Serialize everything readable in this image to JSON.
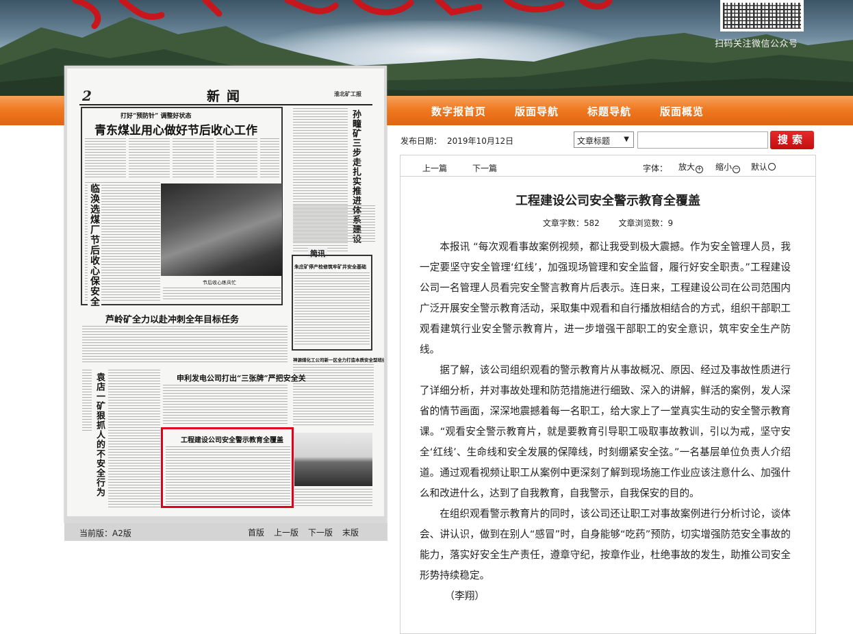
{
  "banner": {
    "qr_caption": "扫码关注微信公众号"
  },
  "nav": {
    "items": [
      "数字报首页",
      "版面导航",
      "标题导航",
      "版面概览"
    ]
  },
  "paper": {
    "page_number": "2",
    "section": "新闻",
    "masthead": "淮北矿工报",
    "headlines": {
      "kicker": "打好“预防针” 调整好状态",
      "main": "青东煤业用心做好节后收心工作",
      "vertical_right": "孙疃矿三步走扎实推进体系建设",
      "vertical_left": "临涣选煤厂节后收心保安全",
      "photo_caption": "节后收心练兵忙",
      "brief_tag": "简讯",
      "brief_title": "朱庄矿停产检修筑牢矿井安全基础",
      "luling": "芦岭矿全力以赴冲刺全年目标任务",
      "power": "申利发电公司打出“三张牌”严把安全关",
      "highlight": "工程建设公司安全警示教育全覆盖",
      "shenmeng": "神源煤化工公司新一区全力打造本质安全型班组",
      "yuandian": "袁店一矿狠抓人的不安全行为"
    }
  },
  "page_nav": {
    "current": "当前版：A2版",
    "links": [
      "首版",
      "上一版",
      "下一版",
      "末版"
    ]
  },
  "article_header": {
    "date_label": "发布日期：",
    "date_value": "2019年10月12日",
    "search_field": "文章标题",
    "search_button": "搜索"
  },
  "toolbar": {
    "prev": "上一篇",
    "next": "下一篇",
    "font_label": "字体：",
    "font_big": "放大",
    "font_small": "缩小",
    "font_default": "默认"
  },
  "article": {
    "title": "工程建设公司安全警示教育全覆盖",
    "word_count": "文章字数：582",
    "view_count": "文章浏览数：9",
    "paragraphs": [
      "本报讯 “每次观看事故案例视频，都让我受到极大震撼。作为安全管理人员，我一定要坚守安全管理‘红线’，加强现场管理和安全监督，履行好安全职责。”工程建设公司一名管理人员看完安全警言教育片后表示。连日来，工程建设公司在公司范围内广泛开展安全警示教育活动，采取集中观看和自行播放相结合的方式，组织干部职工观看建筑行业安全警示教育片，进一步增强干部职工的安全意识，筑牢安全生产防线。",
      "据了解，该公司组织观看的警示教育片从事故概况、原因、经过及事故性质进行了详细分析，并对事故处理和防范措施进行细致、深入的讲解，鲜活的案例，发人深省的情节画面，深深地震撼着每一名职工，给大家上了一堂真实生动的安全警示教育课。“观看安全警示教育片，就是要教育引导职工吸取事故教训，引以为戒，坚守安全‘红线’、生命线和安全发展的保障线，时刻绷紧安全弦。”一名基层单位负责人介绍道。通过观看视频让职工从案例中更深刻了解到现场施工作业应该注意什么、加强什么和改进什么，达到了自我教育，自我警示，自我保安的目的。",
      "在组织观看警示教育片的同时，该公司还让职工对事故案例进行分析讨论，谈体会、讲认识，做到在别人“感冒”时，自身能够“吃药”预防，切实增强防范安全事故的能力，落实好安全生产责任，遵章守纪，按章作业，杜绝事故的发生，助推公司安全形势持续稳定。"
    ],
    "author": "（李翔）"
  }
}
